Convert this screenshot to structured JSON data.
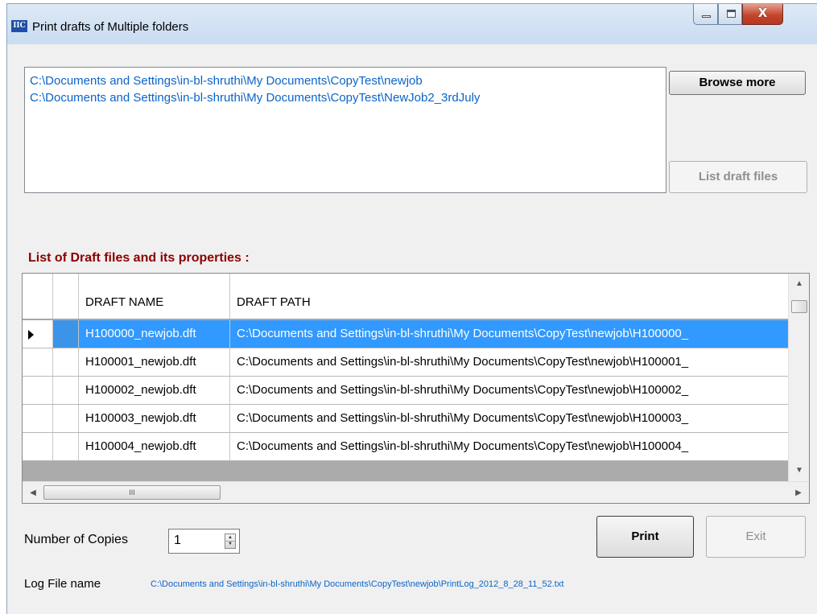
{
  "window": {
    "title": "Print drafts of Multiple folders",
    "app_icon_text": "IIC",
    "controls": {
      "minimize_icon": "minimize-icon",
      "maximize_icon": "maximize-icon",
      "close_glyph": "X"
    }
  },
  "folders": {
    "items": [
      "C:\\Documents and Settings\\in-bl-shruthi\\My Documents\\CopyTest\\newjob",
      "C:\\Documents and Settings\\in-bl-shruthi\\My Documents\\CopyTest\\NewJob2_3rdJuly"
    ]
  },
  "buttons": {
    "browse_more": "Browse more",
    "list_draft_files": "List draft files",
    "print": "Print",
    "exit": "Exit"
  },
  "drafts_section": {
    "label": "List of Draft files and its properties :",
    "columns": [
      "DRAFT NAME",
      "DRAFT PATH"
    ],
    "rows": [
      {
        "name": "H100000_newjob.dft",
        "path": "C:\\Documents and Settings\\in-bl-shruthi\\My Documents\\CopyTest\\newjob\\H100000_"
      },
      {
        "name": "H100001_newjob.dft",
        "path": "C:\\Documents and Settings\\in-bl-shruthi\\My Documents\\CopyTest\\newjob\\H100001_"
      },
      {
        "name": "H100002_newjob.dft",
        "path": "C:\\Documents and Settings\\in-bl-shruthi\\My Documents\\CopyTest\\newjob\\H100002_"
      },
      {
        "name": "H100003_newjob.dft",
        "path": "C:\\Documents and Settings\\in-bl-shruthi\\My Documents\\CopyTest\\newjob\\H100003_"
      },
      {
        "name": "H100004_newjob.dft",
        "path": "C:\\Documents and Settings\\in-bl-shruthi\\My Documents\\CopyTest\\newjob\\H100004_"
      }
    ],
    "selected_row": 0,
    "hscroll_thumb_glyph": "III"
  },
  "copies": {
    "label": "Number of Copies",
    "value": "1"
  },
  "log": {
    "label": "Log File name",
    "value": "C:\\Documents and Settings\\in-bl-shruthi\\My Documents\\CopyTest\\newjob\\PrintLog_2012_8_28_11_52.txt"
  },
  "colors": {
    "link_blue": "#0a64c9",
    "section_red": "#8b0000",
    "selection_blue": "#3199ff"
  }
}
